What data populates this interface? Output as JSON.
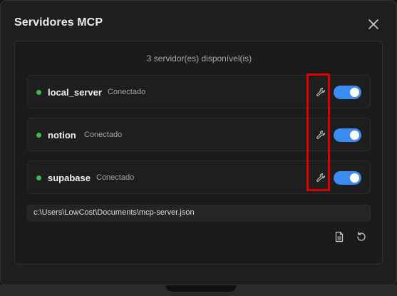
{
  "dialog": {
    "title": "Servidores MCP"
  },
  "panel": {
    "count_text": "3 servidor(es) disponível(is)",
    "servers": [
      {
        "name": "local_server",
        "status": "Conectado",
        "enabled": true
      },
      {
        "name": "notion",
        "status": "Conectado",
        "enabled": true
      },
      {
        "name": "supabase",
        "status": "Conectado",
        "enabled": true
      }
    ],
    "config_path": "c:\\Users\\LowCost\\Documents\\mcp-server.json"
  },
  "colors": {
    "accent": "#3b8cf0",
    "status_connected": "#3fb950",
    "highlight": "#e00000",
    "dialog_bg": "#1f1f1f"
  },
  "icons": {
    "close": "close-icon",
    "configure": "wrench-icon",
    "open_file": "document-icon",
    "reload": "refresh-icon"
  }
}
